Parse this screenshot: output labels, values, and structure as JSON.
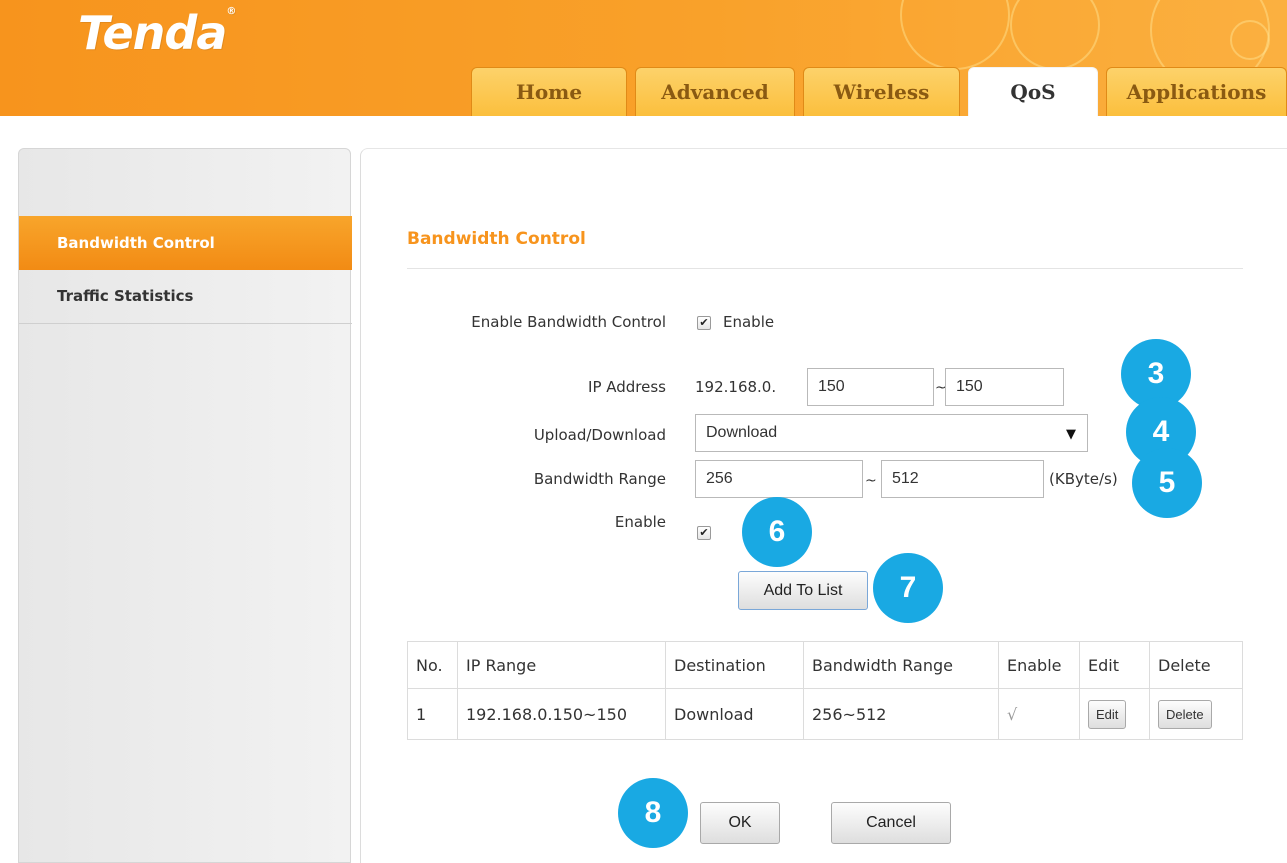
{
  "brand": {
    "logo_text": "Tenda"
  },
  "tabs": [
    {
      "label": "Home",
      "active": false
    },
    {
      "label": "Advanced",
      "active": false
    },
    {
      "label": "Wireless",
      "active": false
    },
    {
      "label": "QoS",
      "active": true
    },
    {
      "label": "Applications",
      "active": false
    }
  ],
  "sidebar": {
    "items": [
      {
        "label": "Bandwidth Control",
        "active": true
      },
      {
        "label": "Traffic Statistics",
        "active": false
      }
    ]
  },
  "main": {
    "title": "Bandwidth Control",
    "form": {
      "enable_bandwidth_label": "Enable Bandwidth Control",
      "enable_bandwidth_checked": true,
      "enable_bandwidth_text": "Enable",
      "ip_label": "IP Address",
      "ip_prefix": "192.168.0.",
      "ip_start": "150",
      "ip_end": "150",
      "ip_sep": "~",
      "updown_label": "Upload/Download",
      "updown_value": "Download",
      "bw_label": "Bandwidth Range",
      "bw_min": "256",
      "bw_max": "512",
      "bw_sep": "~",
      "bw_unit": "(KByte/s)",
      "enable_label": "Enable",
      "enable_checked": true,
      "add_button": "Add To List"
    },
    "table": {
      "headers": [
        "No.",
        "IP Range",
        "Destination",
        "Bandwidth Range",
        "Enable",
        "Edit",
        "Delete"
      ],
      "rows": [
        {
          "no": "1",
          "ip_range": "192.168.0.150~150",
          "destination": "Download",
          "bandwidth": "256~512",
          "enable": "√",
          "edit": "Edit",
          "delete": "Delete"
        }
      ]
    },
    "ok_button": "OK",
    "cancel_button": "Cancel"
  },
  "annotations": [
    "3",
    "4",
    "5",
    "6",
    "7",
    "8"
  ],
  "colors": {
    "brand_orange": "#f7941d",
    "badge_blue": "#19a9e3"
  }
}
